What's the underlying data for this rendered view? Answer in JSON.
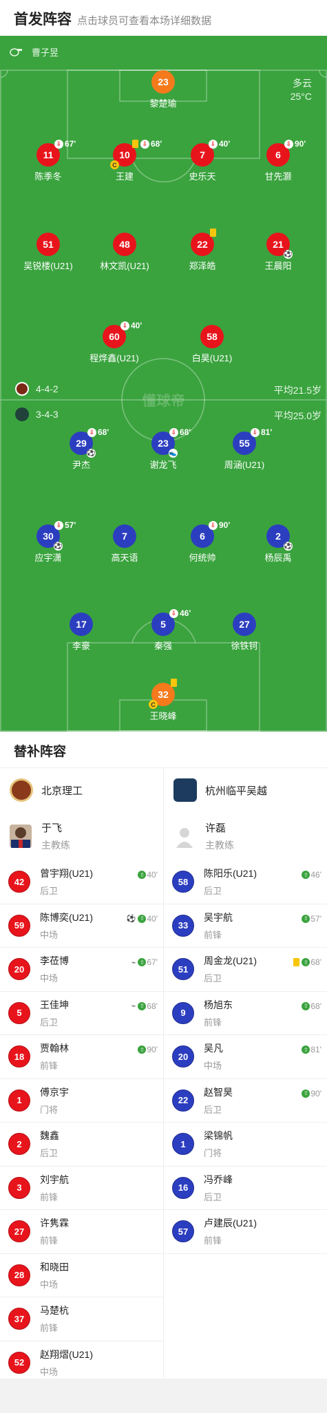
{
  "header": {
    "title": "首发阵容",
    "subtitle": "点击球员可查看本场详细数据"
  },
  "pitch": {
    "referee": "曹子昱",
    "weather": {
      "condition": "多云",
      "temperature": "25°C"
    },
    "watermark": "懂球帝",
    "home_team_row": {
      "formation": "4-4-2",
      "avg_age": "平均21.5岁"
    },
    "away_team_row": {
      "formation": "3-4-3",
      "avg_age": "平均25.0岁"
    },
    "home_players": [
      {
        "number": "23",
        "name": "黎楚瑜",
        "color": "orange"
      },
      {
        "number": "11",
        "name": "陈季冬",
        "sub_minute": "67'"
      },
      {
        "number": "10",
        "name": "王建",
        "sub_minute": "68'",
        "yellow": true,
        "captain": "C"
      },
      {
        "number": "7",
        "name": "史乐天",
        "sub_minute": "40'"
      },
      {
        "number": "6",
        "name": "甘先灏",
        "sub_minute": "90'"
      },
      {
        "number": "51",
        "name": "吴锐楼(U21)"
      },
      {
        "number": "48",
        "name": "林文凯(U21)"
      },
      {
        "number": "22",
        "name": "郑泽皓",
        "yellow": true
      },
      {
        "number": "21",
        "name": "王晨阳",
        "goal": true
      },
      {
        "number": "60",
        "name": "程烨鑫(U21)",
        "sub_minute": "40'"
      },
      {
        "number": "58",
        "name": "白昊(U21)"
      }
    ],
    "away_players": [
      {
        "number": "29",
        "name": "尹杰",
        "sub_minute": "68'",
        "goal": true
      },
      {
        "number": "23",
        "name": "谢龙飞",
        "sub_minute": "68'",
        "assist": true
      },
      {
        "number": "55",
        "name": "周涵(U21)",
        "sub_minute": "81'"
      },
      {
        "number": "30",
        "name": "应宇潇",
        "sub_minute": "57'",
        "goal": true
      },
      {
        "number": "7",
        "name": "高天语"
      },
      {
        "number": "6",
        "name": "何统帅",
        "sub_minute": "90'"
      },
      {
        "number": "2",
        "name": "杨辰禹",
        "goal": true
      },
      {
        "number": "17",
        "name": "李豪"
      },
      {
        "number": "5",
        "name": "秦强",
        "sub_minute": "46'"
      },
      {
        "number": "27",
        "name": "徐铁钶"
      },
      {
        "number": "32",
        "name": "王晓峰",
        "color": "orange",
        "yellow": true,
        "captain": "C"
      }
    ]
  },
  "subs": {
    "title": "替补阵容",
    "home": {
      "team_name": "北京理工",
      "coach": {
        "name": "于飞",
        "role": "主教练"
      },
      "players": [
        {
          "number": "42",
          "name": "曾宇翔(U21)",
          "position": "后卫",
          "in_minute": "40'"
        },
        {
          "number": "59",
          "name": "陈博奕(U21)",
          "position": "中场",
          "in_minute": "40'",
          "goal": true
        },
        {
          "number": "20",
          "name": "李莅博",
          "position": "中场",
          "in_minute": "67'",
          "assist": true
        },
        {
          "number": "5",
          "name": "王佳坤",
          "position": "后卫",
          "in_minute": "68'",
          "assist": true
        },
        {
          "number": "18",
          "name": "贾翰林",
          "position": "前锋",
          "in_minute": "90'"
        },
        {
          "number": "1",
          "name": "傅京宇",
          "position": "门将"
        },
        {
          "number": "2",
          "name": "魏鑫",
          "position": "后卫"
        },
        {
          "number": "3",
          "name": "刘宇航",
          "position": "前锋"
        },
        {
          "number": "27",
          "name": "许隽霖",
          "position": "前锋"
        },
        {
          "number": "28",
          "name": "和晓田",
          "position": "中场"
        },
        {
          "number": "37",
          "name": "马楚杭",
          "position": "前锋"
        },
        {
          "number": "52",
          "name": "赵翔熠(U21)",
          "position": "中场"
        }
      ]
    },
    "away": {
      "team_name": "杭州临平吴越",
      "coach": {
        "name": "许磊",
        "role": "主教练"
      },
      "players": [
        {
          "number": "58",
          "name": "陈阳乐(U21)",
          "position": "后卫",
          "in_minute": "46'"
        },
        {
          "number": "33",
          "name": "吴宇航",
          "position": "前锋",
          "in_minute": "57'"
        },
        {
          "number": "51",
          "name": "周金龙(U21)",
          "position": "后卫",
          "in_minute": "68'",
          "yellow": true
        },
        {
          "number": "9",
          "name": "杨旭东",
          "position": "前锋",
          "in_minute": "68'"
        },
        {
          "number": "20",
          "name": "吴凡",
          "position": "中场",
          "in_minute": "81'"
        },
        {
          "number": "22",
          "name": "赵智昊",
          "position": "后卫",
          "in_minute": "90'"
        },
        {
          "number": "1",
          "name": "梁锦帆",
          "position": "门将"
        },
        {
          "number": "16",
          "name": "冯乔峰",
          "position": "后卫"
        },
        {
          "number": "57",
          "name": "卢建辰(U21)",
          "position": "前锋"
        }
      ]
    }
  }
}
